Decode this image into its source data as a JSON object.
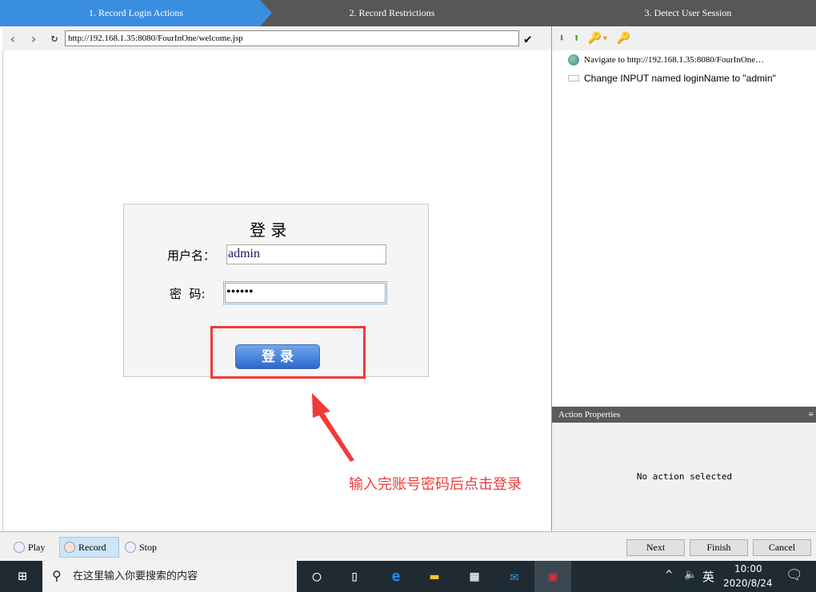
{
  "steps": [
    "1. Record Login Actions",
    "2. Record Restrictions",
    "3. Detect User Session"
  ],
  "nav": {
    "url": "http://192.168.1.35:8080/FourInOne/welcome.jsp"
  },
  "actions": [
    "Navigate to http://192.168.1.35:8080/FourInOne…",
    "Change INPUT named loginName to \"admin\""
  ],
  "props": {
    "title": "Action Properties",
    "empty": "No action selected"
  },
  "login": {
    "title": "登 录",
    "user_label": "用户名：",
    "user_value": "admin",
    "pwd_label": "密  码:",
    "pwd_value": "••••••",
    "button": "登 录"
  },
  "annotation": "输入完账号密码后点击登录",
  "playback": {
    "play": "Play",
    "record": "Record",
    "stop": "Stop"
  },
  "wizard": {
    "next": "Next",
    "finish": "Finish",
    "cancel": "Cancel"
  },
  "taskbar": {
    "search_placeholder": "在这里输入你要搜索的内容",
    "ime": "英",
    "time": "10:00",
    "date": "2020/8/24"
  },
  "colors": {
    "active_step": "#3a8ee0",
    "annotation": "#f03a3a"
  }
}
